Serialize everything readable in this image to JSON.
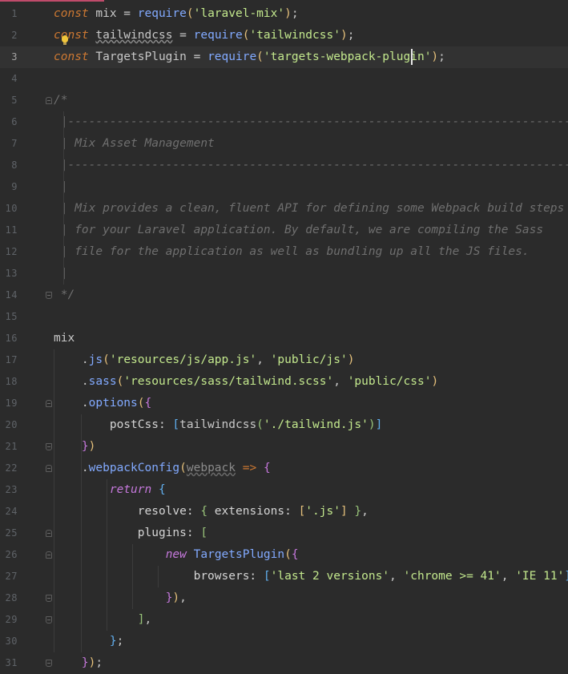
{
  "editor": {
    "current_line": 3,
    "lines": [
      {
        "n": "1",
        "parts": [
          [
            "kw-i",
            "const"
          ],
          [
            "plain",
            " mix = "
          ],
          [
            "fn",
            "require"
          ],
          [
            "br1",
            "("
          ],
          [
            "str",
            "'laravel-mix'"
          ],
          [
            "br1",
            ")"
          ],
          [
            "plain",
            ";"
          ]
        ]
      },
      {
        "n": "2",
        "parts": [
          [
            "kw-i",
            "const"
          ],
          [
            "plain",
            " "
          ],
          [
            "wavy",
            "tailwindcss"
          ],
          [
            "plain",
            " = "
          ],
          [
            "fn",
            "require"
          ],
          [
            "br1",
            "("
          ],
          [
            "str",
            "'tailwindcss'"
          ],
          [
            "br1",
            ")"
          ],
          [
            "plain",
            ";"
          ]
        ]
      },
      {
        "n": "3",
        "parts": [
          [
            "kw-i",
            "const"
          ],
          [
            "plain",
            " TargetsPlugin = "
          ],
          [
            "fn",
            "require"
          ],
          [
            "br1",
            "("
          ],
          [
            "str",
            "'targets-webpack-plugin'"
          ],
          [
            "br1",
            ")"
          ],
          [
            "plain",
            ";"
          ]
        ]
      },
      {
        "n": "4",
        "parts": []
      },
      {
        "n": "5",
        "parts": [
          [
            "cm",
            "/*"
          ]
        ]
      },
      {
        "n": "6",
        "parts": [
          [
            "cm",
            " |--------------------------------------------------------------------------"
          ]
        ]
      },
      {
        "n": "7",
        "parts": [
          [
            "cm",
            " | Mix Asset Management"
          ]
        ]
      },
      {
        "n": "8",
        "parts": [
          [
            "cm",
            " |--------------------------------------------------------------------------"
          ]
        ]
      },
      {
        "n": "9",
        "parts": [
          [
            "cm",
            " |"
          ]
        ]
      },
      {
        "n": "10",
        "parts": [
          [
            "cm",
            " | Mix provides a clean, fluent API for defining some Webpack build steps"
          ]
        ]
      },
      {
        "n": "11",
        "parts": [
          [
            "cm",
            " | for your Laravel application. By default, we are compiling the Sass"
          ]
        ]
      },
      {
        "n": "12",
        "parts": [
          [
            "cm",
            " | file for the application as well as bundling up all the JS files."
          ]
        ]
      },
      {
        "n": "13",
        "parts": [
          [
            "cm",
            " |"
          ]
        ]
      },
      {
        "n": "14",
        "parts": [
          [
            "cm",
            " */"
          ]
        ]
      },
      {
        "n": "15",
        "parts": []
      },
      {
        "n": "16",
        "parts": [
          [
            "plain",
            "mix"
          ]
        ]
      },
      {
        "n": "17",
        "parts": [
          [
            "plain",
            "    ."
          ],
          [
            "fn",
            "js"
          ],
          [
            "br1",
            "("
          ],
          [
            "str",
            "'resources/js/app.js'"
          ],
          [
            "plain",
            ", "
          ],
          [
            "str",
            "'public/js'"
          ],
          [
            "br1",
            ")"
          ]
        ]
      },
      {
        "n": "18",
        "parts": [
          [
            "plain",
            "    ."
          ],
          [
            "fn",
            "sass"
          ],
          [
            "br1",
            "("
          ],
          [
            "str",
            "'resources/sass/tailwind.scss'"
          ],
          [
            "plain",
            ", "
          ],
          [
            "str",
            "'public/css'"
          ],
          [
            "br1",
            ")"
          ]
        ]
      },
      {
        "n": "19",
        "parts": [
          [
            "plain",
            "    ."
          ],
          [
            "fn",
            "options"
          ],
          [
            "br1",
            "("
          ],
          [
            "br2",
            "{"
          ]
        ]
      },
      {
        "n": "20",
        "parts": [
          [
            "prop",
            "        postCss: "
          ],
          [
            "br3",
            "["
          ],
          [
            "plain",
            "tailwindcss"
          ],
          [
            "br4",
            "("
          ],
          [
            "str",
            "'./tailwind.js'"
          ],
          [
            "br4",
            ")"
          ],
          [
            "br3",
            "]"
          ]
        ]
      },
      {
        "n": "21",
        "parts": [
          [
            "plain",
            "    "
          ],
          [
            "br2",
            "}"
          ],
          [
            "br1",
            ")"
          ]
        ]
      },
      {
        "n": "22",
        "parts": [
          [
            "plain",
            "    ."
          ],
          [
            "fn",
            "webpackConfig"
          ],
          [
            "br1",
            "("
          ],
          [
            "param",
            "webpack"
          ],
          [
            "plain",
            " "
          ],
          [
            "kw",
            "=>"
          ],
          [
            "plain",
            " "
          ],
          [
            "br2",
            "{"
          ]
        ]
      },
      {
        "n": "23",
        "parts": [
          [
            "plain",
            "        "
          ],
          [
            "kw-p",
            "return"
          ],
          [
            "plain",
            " "
          ],
          [
            "br3",
            "{"
          ]
        ]
      },
      {
        "n": "24",
        "parts": [
          [
            "prop",
            "            resolve: "
          ],
          [
            "br4",
            "{"
          ],
          [
            "prop",
            " extensions: "
          ],
          [
            "br1",
            "["
          ],
          [
            "str",
            "'.js'"
          ],
          [
            "br1",
            "]"
          ],
          [
            "plain",
            " "
          ],
          [
            "br4",
            "}"
          ],
          [
            "plain",
            ","
          ]
        ]
      },
      {
        "n": "25",
        "parts": [
          [
            "prop",
            "            plugins: "
          ],
          [
            "br4",
            "["
          ]
        ]
      },
      {
        "n": "26",
        "parts": [
          [
            "plain",
            "                "
          ],
          [
            "kw-p",
            "new"
          ],
          [
            "plain",
            " "
          ],
          [
            "cls",
            "TargetsPlugin"
          ],
          [
            "br1",
            "("
          ],
          [
            "br2",
            "{"
          ]
        ]
      },
      {
        "n": "27",
        "parts": [
          [
            "prop",
            "                    browsers: "
          ],
          [
            "br3",
            "["
          ],
          [
            "str",
            "'last 2 versions'"
          ],
          [
            "plain",
            ", "
          ],
          [
            "str",
            "'chrome >= 41'"
          ],
          [
            "plain",
            ", "
          ],
          [
            "str",
            "'IE 11'"
          ],
          [
            "br3",
            "]"
          ],
          [
            "plain",
            ","
          ]
        ]
      },
      {
        "n": "28",
        "parts": [
          [
            "plain",
            "                "
          ],
          [
            "br2",
            "}"
          ],
          [
            "br1",
            ")"
          ],
          [
            "plain",
            ","
          ]
        ]
      },
      {
        "n": "29",
        "parts": [
          [
            "plain",
            "            "
          ],
          [
            "br4",
            "]"
          ],
          [
            "plain",
            ","
          ]
        ]
      },
      {
        "n": "30",
        "parts": [
          [
            "plain",
            "        "
          ],
          [
            "br3",
            "}"
          ],
          [
            "plain",
            ";"
          ]
        ]
      },
      {
        "n": "31",
        "parts": [
          [
            "plain",
            "    "
          ],
          [
            "br2",
            "}"
          ],
          [
            "br1",
            ")"
          ],
          [
            "plain",
            ";"
          ]
        ]
      }
    ]
  },
  "fold_markers": {
    "5": "open",
    "14": "close",
    "19": "open",
    "21": "close",
    "22": "open",
    "25": "open",
    "26": "open",
    "28": "close",
    "29": "close",
    "31": "close"
  },
  "icons": {
    "intention": "lightbulb-icon",
    "fold_expand": "fold-marker-icon"
  },
  "colors": {
    "background": "#2b2b2b",
    "current_line": "#323232",
    "keyword": "#cc7832",
    "string": "#c3e88d",
    "function": "#82aaff",
    "comment": "#6f6f6f",
    "caret": "#e8e8e8",
    "accent": "#c04b6b"
  }
}
